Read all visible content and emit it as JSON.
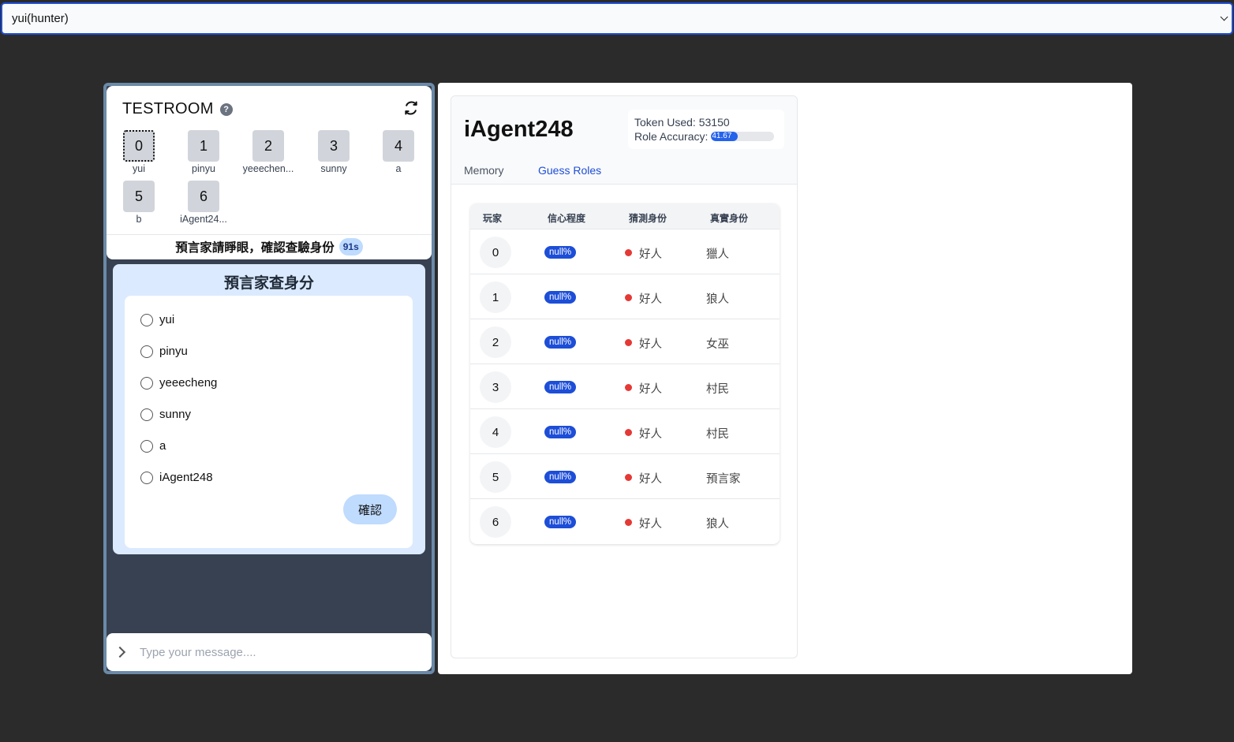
{
  "top_select": {
    "value": "yui(hunter)"
  },
  "room": {
    "title": "TESTROOM",
    "players": [
      {
        "num": "0",
        "name": "yui"
      },
      {
        "num": "1",
        "name": "pinyu"
      },
      {
        "num": "2",
        "name": "yeeechen..."
      },
      {
        "num": "3",
        "name": "sunny"
      },
      {
        "num": "4",
        "name": "a"
      },
      {
        "num": "5",
        "name": "b"
      },
      {
        "num": "6",
        "name": "iAgent24..."
      }
    ],
    "phase_text": "預言家請睜眼，確認查驗身份",
    "timer": "91s"
  },
  "seer": {
    "title": "預言家查身分",
    "options": [
      "yui",
      "pinyu",
      "yeeecheng",
      "sunny",
      "a",
      "iAgent248"
    ],
    "confirm_label": "確認"
  },
  "message": {
    "placeholder": "Type your message...."
  },
  "agent": {
    "name": "iAgent248",
    "token_label": "Token Used: 53150",
    "accuracy_label": "Role Accuracy:",
    "accuracy_value": "41.67",
    "accuracy_percent": 41.67,
    "tabs": [
      "Memory",
      "Guess Roles"
    ],
    "active_tab": "Guess Roles"
  },
  "guess_table": {
    "headers": [
      "玩家",
      "信心程度",
      "猜測身份",
      "真實身份"
    ],
    "rows": [
      {
        "player": "0",
        "confidence": "null%",
        "guess": "好人",
        "truth": "獵人"
      },
      {
        "player": "1",
        "confidence": "null%",
        "guess": "好人",
        "truth": "狼人"
      },
      {
        "player": "2",
        "confidence": "null%",
        "guess": "好人",
        "truth": "女巫"
      },
      {
        "player": "3",
        "confidence": "null%",
        "guess": "好人",
        "truth": "村民"
      },
      {
        "player": "4",
        "confidence": "null%",
        "guess": "好人",
        "truth": "村民"
      },
      {
        "player": "5",
        "confidence": "null%",
        "guess": "好人",
        "truth": "預言家"
      },
      {
        "player": "6",
        "confidence": "null%",
        "guess": "好人",
        "truth": "狼人"
      }
    ]
  },
  "colors": {
    "accent": "#1d4ed8",
    "panel_bg": "#374151",
    "seer_bg": "#dbeafe",
    "dot_red": "#e53935"
  }
}
